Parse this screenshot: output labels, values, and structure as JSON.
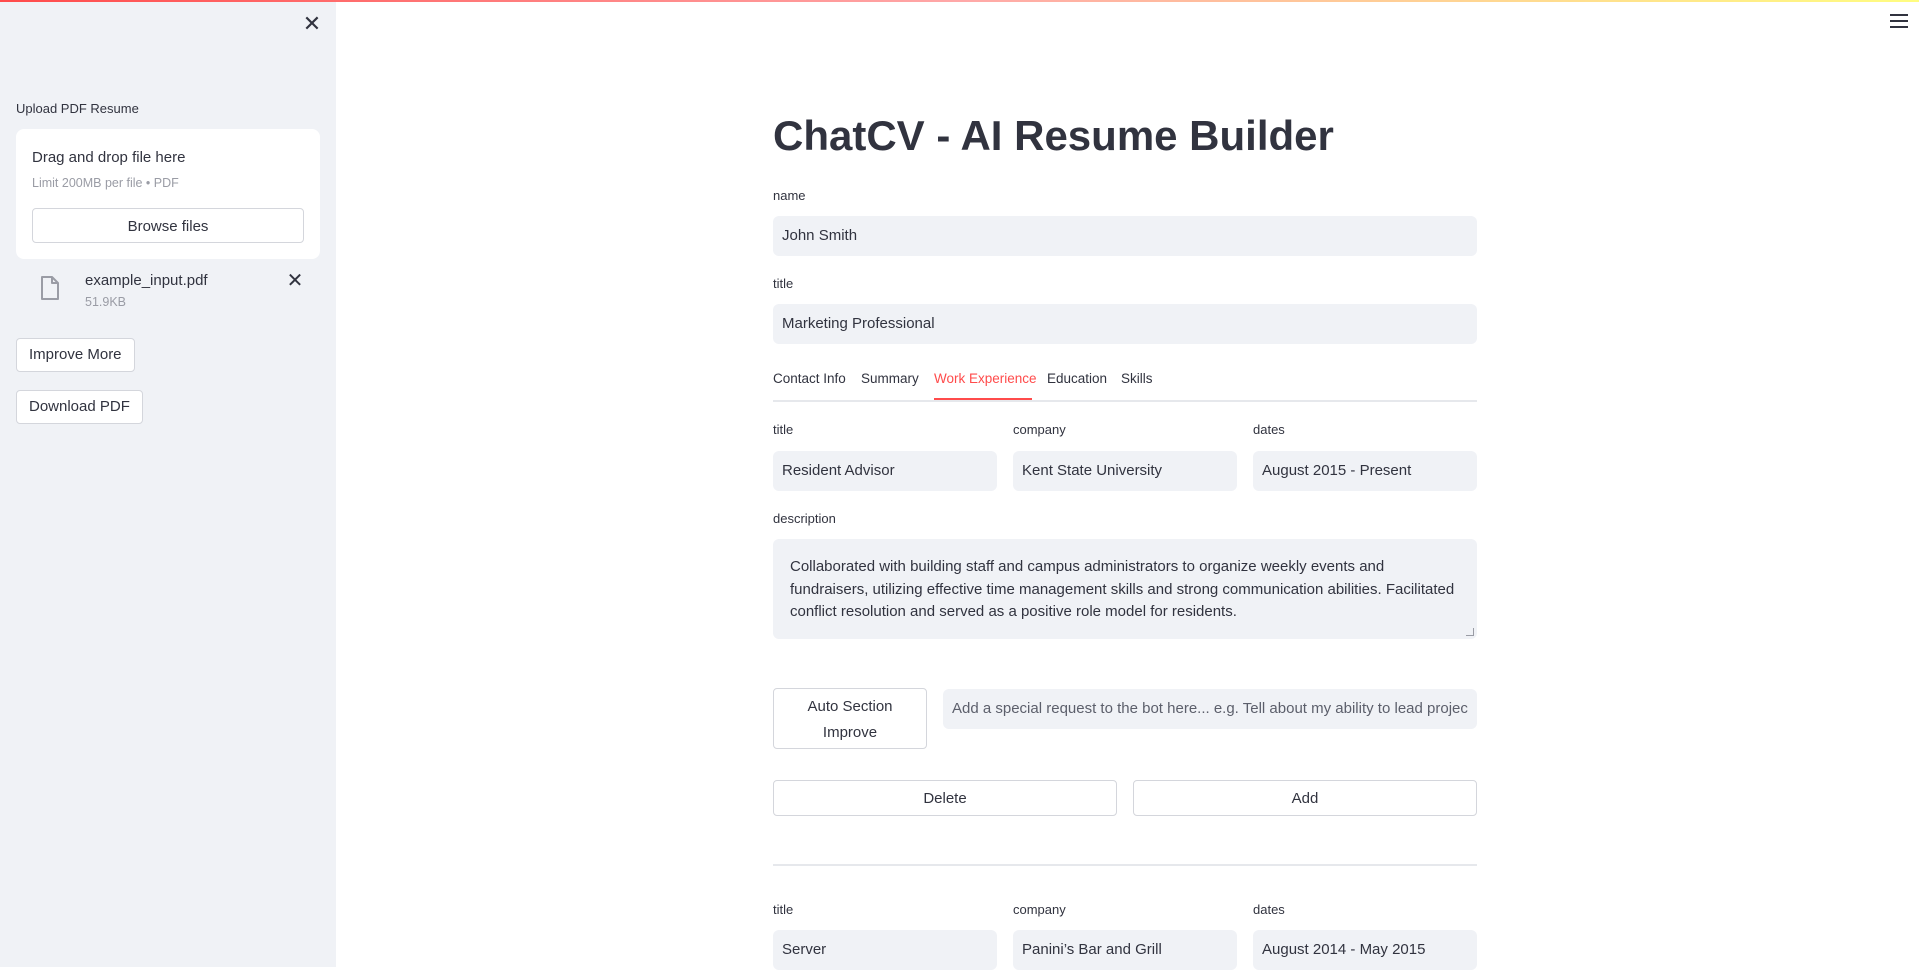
{
  "sidebar": {
    "upload_label": "Upload PDF Resume",
    "dropzone_title": "Drag and drop file here",
    "dropzone_limit": "Limit 200MB per file • PDF",
    "browse_label": "Browse files",
    "file": {
      "name": "example_input.pdf",
      "size": "51.9KB"
    },
    "improve_more_label": "Improve More",
    "download_pdf_label": "Download PDF"
  },
  "header": {
    "title": "ChatCV - AI Resume Builder"
  },
  "fields": {
    "name_label": "name",
    "name_value": "John Smith",
    "title_label": "title",
    "title_value": "Marketing Professional"
  },
  "tabs": [
    {
      "label": "Contact Info"
    },
    {
      "label": "Summary"
    },
    {
      "label": "Work Experience",
      "active": true
    },
    {
      "label": "Education"
    },
    {
      "label": "Skills"
    }
  ],
  "experience": [
    {
      "title_label": "title",
      "title_value": "Resident Advisor",
      "company_label": "company",
      "company_value": "Kent State University",
      "dates_label": "dates",
      "dates_value": "August 2015 - Present",
      "description_label": "description",
      "description_value": "Collaborated with building staff and campus administrators to organize weekly events and fundraisers, utilizing effective time management skills and strong communication abilities. Facilitated conflict resolution and served as a positive role model for residents."
    },
    {
      "title_label": "title",
      "title_value": "Server",
      "company_label": "company",
      "company_value": "Panini’s Bar and Grill",
      "dates_label": "dates",
      "dates_value": "August 2014 - May 2015"
    }
  ],
  "actions": {
    "auto_improve_line1": "Auto Section",
    "auto_improve_line2": "Improve",
    "request_placeholder": "Add a special request to the bot here... e.g. Tell about my ability to lead projec",
    "delete_label": "Delete",
    "add_label": "Add"
  },
  "colors": {
    "accent": "#ff4b4b",
    "sidebar_bg": "#f0f2f6",
    "input_bg": "#f0f2f6",
    "text": "#31333f"
  },
  "icons": {
    "sidebar_close": "close-icon",
    "file": "file-icon",
    "file_remove": "close-icon",
    "menu": "hamburger-menu-icon"
  }
}
